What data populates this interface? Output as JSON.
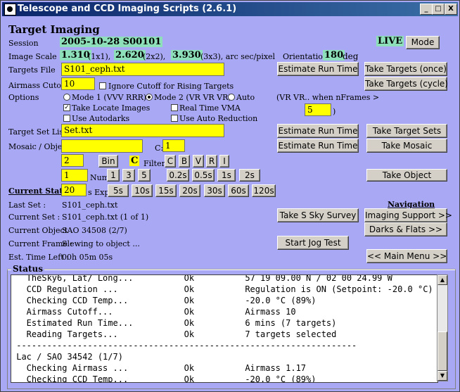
{
  "window": {
    "title": "Telescope and CCD Imaging Scripts (2.6.1)",
    "min": "_",
    "max": "□",
    "close": "X"
  },
  "heading": "Target Imaging",
  "session": {
    "label": "Session",
    "value": "2005-10-28 S00101"
  },
  "live": "LIVE",
  "mode_button": "Mode",
  "image_scale": {
    "label": "Image Scale",
    "v1": "1.310",
    "u1": "(1x1),",
    "v2": "2.620",
    "u2": "(2x2),",
    "v3": "3.930",
    "u3": "(3x3), arc sec/pixel"
  },
  "orientation": {
    "label": "Orientation",
    "value": "180",
    "unit": "deg"
  },
  "targets_file": {
    "label": "Targets File",
    "value": "S101_ceph.txt"
  },
  "buttons": {
    "estimate_run_time_1": "Estimate Run Time",
    "take_targets_once": "Take Targets (once)",
    "take_targets_cycle": "Take Targets (cycle)",
    "estimate_run_time_2": "Estimate Run Time",
    "take_target_sets": "Take Target Sets",
    "estimate_run_time_3": "Estimate Run Time",
    "take_mosaic": "Take Mosaic",
    "take_object": "Take Object",
    "take_s_sky_survey": "Take S Sky Survey",
    "imaging_support": "Imaging Support >>",
    "darks_flats": "Darks & Flats >>",
    "start_jog_test": "Start Jog Test",
    "main_menu": "<< Main Menu >>"
  },
  "airmass_cutoff": {
    "label": "Airmass Cutoff",
    "value": "10",
    "ignore_label": "Ignore Cutoff for Rising Targets"
  },
  "options": {
    "label": "Options",
    "mode1": "Mode 1 (VVV RRR)",
    "mode2": "Mode 2 (VR VR VR)",
    "auto": "Auto",
    "take_locate": "Take Locate Images",
    "realtime_vma": "Real Time VMA",
    "use_autodarks": "Use Autodarks",
    "use_auto_reduction": "Use Auto Reduction",
    "vr_note": "(VR VR.. when nFrames >",
    "nframes": "5",
    "paren": ")"
  },
  "target_set_list": {
    "label": "Target Set List",
    "value": "Set.txt"
  },
  "mosaic": {
    "label": "Mosaic / Object",
    "value": "",
    "c_label": "C:",
    "c_value": "1"
  },
  "bin": {
    "value": "2",
    "button": "Bin"
  },
  "filter": {
    "current": "C",
    "label": "Filter",
    "options": [
      "C",
      "B",
      "V",
      "R",
      "I"
    ]
  },
  "num": {
    "value": "1",
    "label": "Num",
    "options": [
      "1",
      "3",
      "5"
    ]
  },
  "exp_short": [
    "0.2s",
    "0.5s",
    "1s",
    "2s"
  ],
  "exp": {
    "value": "20",
    "label": "s Exp",
    "options": [
      "5s",
      "10s",
      "15s",
      "20s",
      "30s",
      "60s",
      "120s"
    ]
  },
  "current_status": "Current Status",
  "last_set": {
    "label": "Last Set :",
    "value": "S101_ceph.txt"
  },
  "current_set": {
    "label": "Current Set :",
    "value": "S101_ceph.txt (1 of 1)"
  },
  "current_object": {
    "label": "Current Object",
    "value": "SAO 34508 (2/7)"
  },
  "current_frame": {
    "label": "Current Frame :",
    "value": "Slewing to object ..."
  },
  "est_time_left": {
    "label": "Est. Time Left :",
    "value": "00h 05m 05s"
  },
  "navigation": "Navigation",
  "status": {
    "title": "Status",
    "lines": [
      "   TheSky6, Lat/ Long...          Ok          57 19 09.00 N / 02 00 24.99 W",
      "   CCD Regulation ...             Ok          Regulation is ON (Setpoint: -20.0 °C)",
      "   Checking CCD Temp...           Ok          -20.0 °C (89%)",
      "   Airmass Cutoff...              Ok          Airmass 10",
      "   Estimated Run Time...          Ok          6 mins (7 targets)",
      "   Reading Targets...             Ok          7 targets selected",
      " -------------------------------------------------------------------",
      " Lac / SAO 34542 (1/7)",
      "   Checking Airmass ...           Ok          Airmass 1.17",
      "   Checking CCD Temp...           Ok          -20.0 °C (89%)"
    ]
  }
}
